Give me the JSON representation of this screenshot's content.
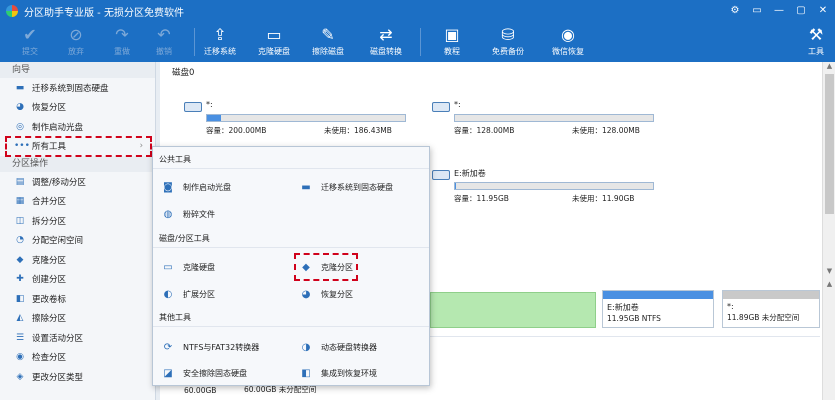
{
  "window": {
    "title": "分区助手专业版 - 无损分区免费软件"
  },
  "window_buttons": [
    "⚙",
    "▭",
    "—",
    "▢",
    "✕"
  ],
  "toolbar": {
    "buttons": [
      {
        "label": "提交",
        "icon": "✔",
        "enabled": false
      },
      {
        "label": "放弃",
        "icon": "⊘",
        "enabled": false
      },
      {
        "label": "重做",
        "icon": "↷",
        "enabled": false
      },
      {
        "label": "撤销",
        "icon": "↶",
        "enabled": false
      },
      {
        "label": "迁移系统",
        "icon": "⇪",
        "enabled": true
      },
      {
        "label": "克隆硬盘",
        "icon": "▭",
        "enabled": true
      },
      {
        "label": "擦除磁盘",
        "icon": "✎",
        "enabled": true
      },
      {
        "label": "磁盘转换",
        "icon": "⇄",
        "enabled": true
      },
      {
        "label": "教程",
        "icon": "▣",
        "enabled": true
      },
      {
        "label": "免费备份",
        "icon": "⛁",
        "enabled": true
      },
      {
        "label": "微信恢复",
        "icon": "◉",
        "enabled": true
      },
      {
        "label": "工具",
        "icon": "⚒",
        "enabled": true
      }
    ]
  },
  "sidebar": {
    "guide_header": "向导",
    "guide_items": [
      {
        "label": "迁移系统到固态硬盘",
        "icon": "▬"
      },
      {
        "label": "恢复分区",
        "icon": "◕"
      },
      {
        "label": "制作启动光盘",
        "icon": "◎"
      },
      {
        "label": "所有工具",
        "icon": "•••",
        "arrow": "›"
      }
    ],
    "ops_header": "分区操作",
    "ops_items": [
      {
        "label": "调整/移动分区",
        "icon": "▤"
      },
      {
        "label": "合并分区",
        "icon": "▦"
      },
      {
        "label": "拆分分区",
        "icon": "◫"
      },
      {
        "label": "分配空闲空间",
        "icon": "◔"
      },
      {
        "label": "克隆分区",
        "icon": "◆"
      },
      {
        "label": "创建分区",
        "icon": "✚"
      },
      {
        "label": "更改卷标",
        "icon": "◧"
      },
      {
        "label": "擦除分区",
        "icon": "◭"
      },
      {
        "label": "设置活动分区",
        "icon": "☰"
      },
      {
        "label": "检查分区",
        "icon": "◉"
      },
      {
        "label": "更改分区类型",
        "icon": "◈"
      }
    ]
  },
  "main": {
    "disk_title": "磁盘0",
    "partitions": [
      {
        "name": "*:",
        "cap": "容量：200.00MB",
        "free": "未使用：186.43MB",
        "used_fraction": 0.07
      },
      {
        "name": "*:",
        "cap": "容量：128.00MB",
        "free": "未使用：128.00MB",
        "used_fraction": 0.0
      },
      {
        "name": "E:新加卷",
        "cap": "容量：11.95GB",
        "free": "未使用：11.90GB",
        "used_fraction": 0.004
      }
    ],
    "disk_map": [
      {
        "t1": "E:新加卷",
        "t2": "11.95GB NTFS"
      },
      {
        "t1": "*:",
        "t2": "11.89GB 未分配空间"
      }
    ],
    "bottom_size": "60.00GB",
    "bottom_unalloc": "60.00GB 未分配空间"
  },
  "popup": {
    "sections": [
      {
        "header": "公共工具",
        "items": [
          "制作启动光盘",
          "迁移系统到固态硬盘",
          "粉碎文件"
        ]
      },
      {
        "header": "磁盘/分区工具",
        "items": [
          "克隆硬盘",
          "克隆分区",
          "扩展分区",
          "恢复分区"
        ]
      },
      {
        "header": "其他工具",
        "items": [
          "NTFS与FAT32转换器",
          "动态硬盘转换器",
          "安全擦除固态硬盘",
          "集成到恢复环境"
        ]
      }
    ],
    "icons": [
      "◙",
      "▬",
      "◍",
      "▭",
      "◆",
      "◐",
      "◕",
      "⟳",
      "◑",
      "◪",
      "◧"
    ]
  },
  "colors": {
    "accent": "#1c6fc4",
    "highlight": "#d0021b",
    "bar": "#4a90e2",
    "green": "#b5e8b0"
  }
}
